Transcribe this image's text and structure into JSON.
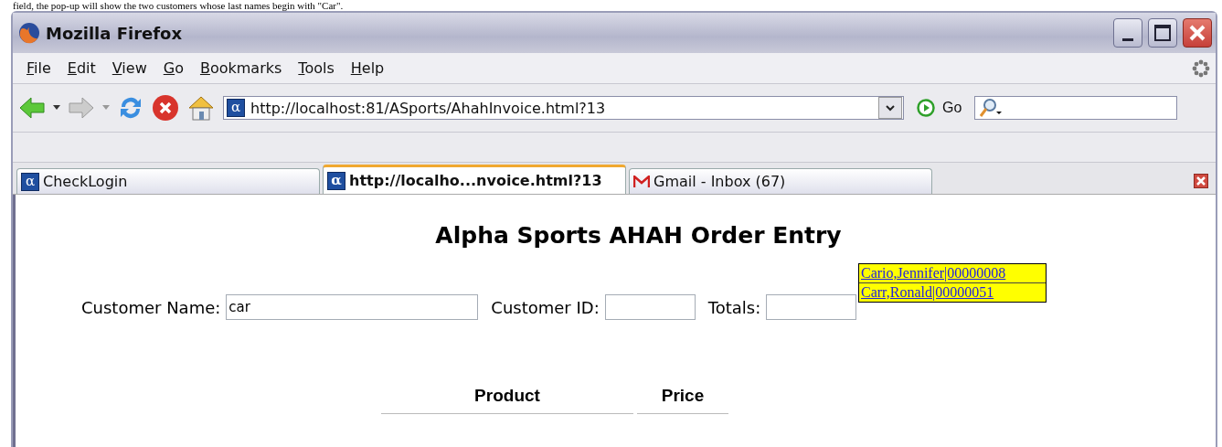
{
  "document_text": "field, the pop-up will show the two customers whose last names begin with \"Car\".",
  "window": {
    "title": "Mozilla Firefox"
  },
  "menu": [
    "File",
    "Edit",
    "View",
    "Go",
    "Bookmarks",
    "Tools",
    "Help"
  ],
  "address": {
    "icon_text": "α",
    "value": "http://localhost:81/ASports/AhahInvoice.html?13"
  },
  "go_button": "Go",
  "tabs": [
    {
      "label": "CheckLogin",
      "selected": false,
      "kind": "alpha",
      "icon_text": "α"
    },
    {
      "label": "http://localho...nvoice.html?13",
      "selected": true,
      "kind": "alpha",
      "icon_text": "α"
    },
    {
      "label": "Gmail - Inbox (67)",
      "selected": false,
      "kind": "mail"
    }
  ],
  "page": {
    "title": "Alpha Sports AHAH Order Entry",
    "fields": [
      {
        "label": "Customer Name:",
        "value": "car"
      },
      {
        "label": "Customer ID:"
      },
      {
        "label": "Totals:"
      }
    ],
    "suggestions": [
      "Cario,Jennifer|00000008",
      "Carr,Ronald|00000051"
    ],
    "table_columns": [
      "Product",
      "Price"
    ]
  }
}
